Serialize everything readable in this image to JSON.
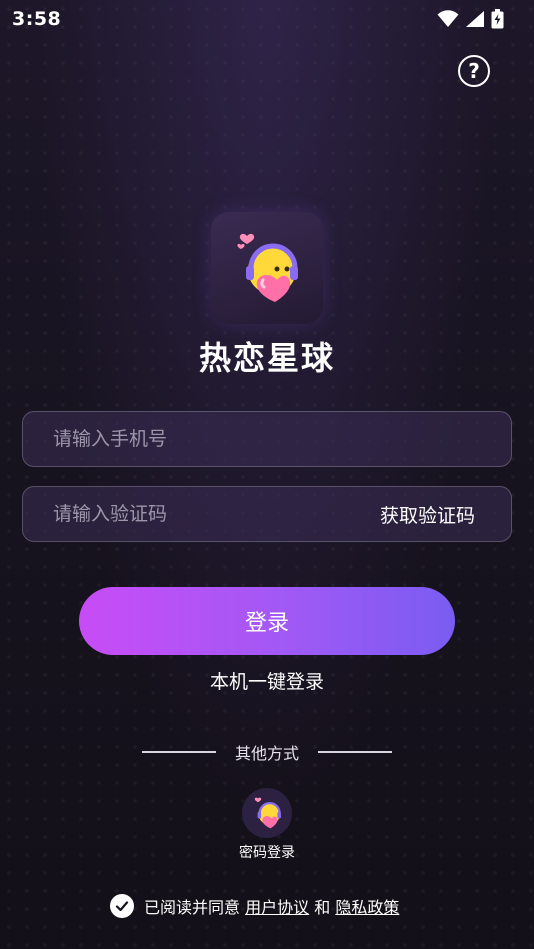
{
  "status_bar": {
    "time": "3:58"
  },
  "app": {
    "name": "热恋星球"
  },
  "form": {
    "phone_placeholder": "请输入手机号",
    "code_placeholder": "请输入验证码",
    "get_code_label": "获取验证码",
    "login_label": "登录",
    "one_key_label": "本机一键登录"
  },
  "other": {
    "divider_label": "其他方式",
    "password_login_label": "密码登录"
  },
  "agreement": {
    "prefix": "已阅读并同意",
    "user_agreement": "用户协议",
    "and": "和",
    "privacy_policy": "隐私政策"
  },
  "colors": {
    "background": "#16121f",
    "button_gradient_start": "#c84cf6",
    "button_gradient_end": "#7a5cf2"
  },
  "icons": [
    "wifi-icon",
    "signal-icon",
    "battery-icon",
    "help-icon",
    "app-logo-icon",
    "password-login-icon",
    "checkbox-checked-icon"
  ]
}
